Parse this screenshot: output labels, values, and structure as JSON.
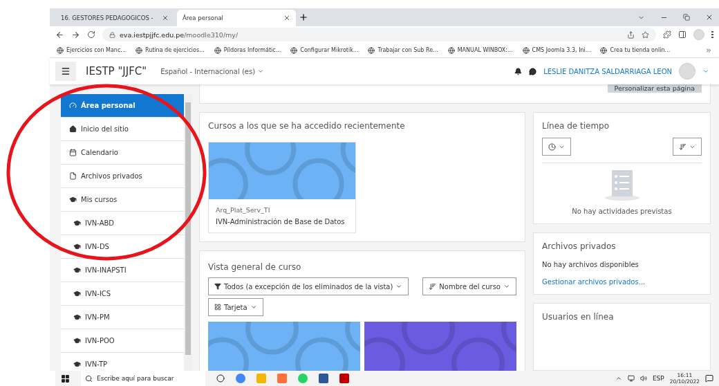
{
  "browser": {
    "tabs": [
      {
        "title": "16. GESTORES PEDAGOGICOS -",
        "selected": false
      },
      {
        "title": "Área personal",
        "selected": true
      }
    ],
    "url_host": "eva.iestpjjfc.edu.pe",
    "url_path": "/moodle310/my/",
    "bookmarks": [
      "Ejercicios con Manc...",
      "Rutina de ejercicios...",
      "Píldoras Informátic...",
      "Configurar Mikrotik...",
      "Trabajar con Sub Re...",
      "MANUAL WINBOX:...",
      "CMS Joomla 3.3, Ini...",
      "Crea tu tienda onlin..."
    ]
  },
  "navbar": {
    "site_name": "IESTP \"JJFC\"",
    "language": "Español - Internacional (es)",
    "user_name": "LESLIE DANITZA SALDARRIAGA LEON"
  },
  "page_button": "Personalizar esta página",
  "sidebar": {
    "items": [
      {
        "label": "Área personal",
        "selected": true,
        "kind": "dashboard"
      },
      {
        "label": "Inicio del sitio",
        "selected": false,
        "kind": "home"
      },
      {
        "label": "Calendario",
        "selected": false,
        "kind": "calendar"
      },
      {
        "label": "Archivos privados",
        "selected": false,
        "kind": "file"
      },
      {
        "label": "Mis cursos",
        "selected": false,
        "kind": "courses"
      },
      {
        "label": "IVN-ABD",
        "selected": false,
        "kind": "course"
      },
      {
        "label": "IVN-DS",
        "selected": false,
        "kind": "course"
      },
      {
        "label": "IVN-INAPSTI",
        "selected": false,
        "kind": "course"
      },
      {
        "label": "IVN-ICS",
        "selected": false,
        "kind": "course"
      },
      {
        "label": "IVN-PM",
        "selected": false,
        "kind": "course"
      },
      {
        "label": "IVN-POO",
        "selected": false,
        "kind": "course"
      },
      {
        "label": "IVN-TP",
        "selected": false,
        "kind": "course"
      }
    ]
  },
  "recent": {
    "title": "Cursos a los que se ha accedido recientemente",
    "courses": [
      {
        "category": "Arq_Plat_Serv_TI",
        "name": "IVN-Administración de Base de Datos",
        "color": "#6cb2f5"
      }
    ]
  },
  "overview": {
    "title": "Vista general de curso",
    "filter": "Todos (a excepción de los eliminados de la vista)",
    "sort": "Nombre del curso",
    "view": "Tarjeta",
    "courses": [
      {
        "color": "#6cb2f5"
      },
      {
        "color": "#6a5ce0"
      }
    ]
  },
  "timeline": {
    "title": "Línea de tiempo",
    "empty": "No hay actividades previstas"
  },
  "files": {
    "title": "Archivos privados",
    "empty": "No hay archivos disponibles",
    "link": "Gestionar archivos privados..."
  },
  "online": {
    "title": "Usuarios en línea"
  },
  "taskbar": {
    "search_placeholder": "Escribe aquí para buscar",
    "language": "ESP",
    "time": "16:11",
    "date": "20/10/2022"
  }
}
